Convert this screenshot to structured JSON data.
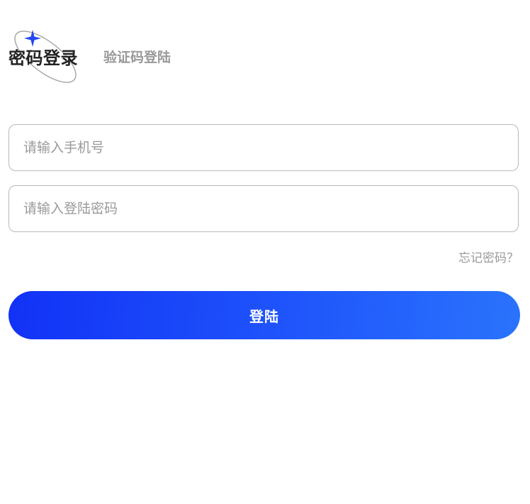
{
  "tabs": {
    "active_label": "密码登录",
    "inactive_label": "验证码登陆"
  },
  "form": {
    "phone_placeholder": "请输入手机号",
    "phone_value": "",
    "password_placeholder": "请输入登陆密码",
    "password_value": "",
    "forgot_label": "忘记密码？",
    "login_label": "登陆"
  },
  "colors": {
    "accent_start": "#1232f6",
    "accent_end": "#2a73fc",
    "text_primary": "#222222",
    "text_muted": "#999999"
  },
  "icons": {
    "tab_decoration": "sparkle-orbit-icon"
  }
}
